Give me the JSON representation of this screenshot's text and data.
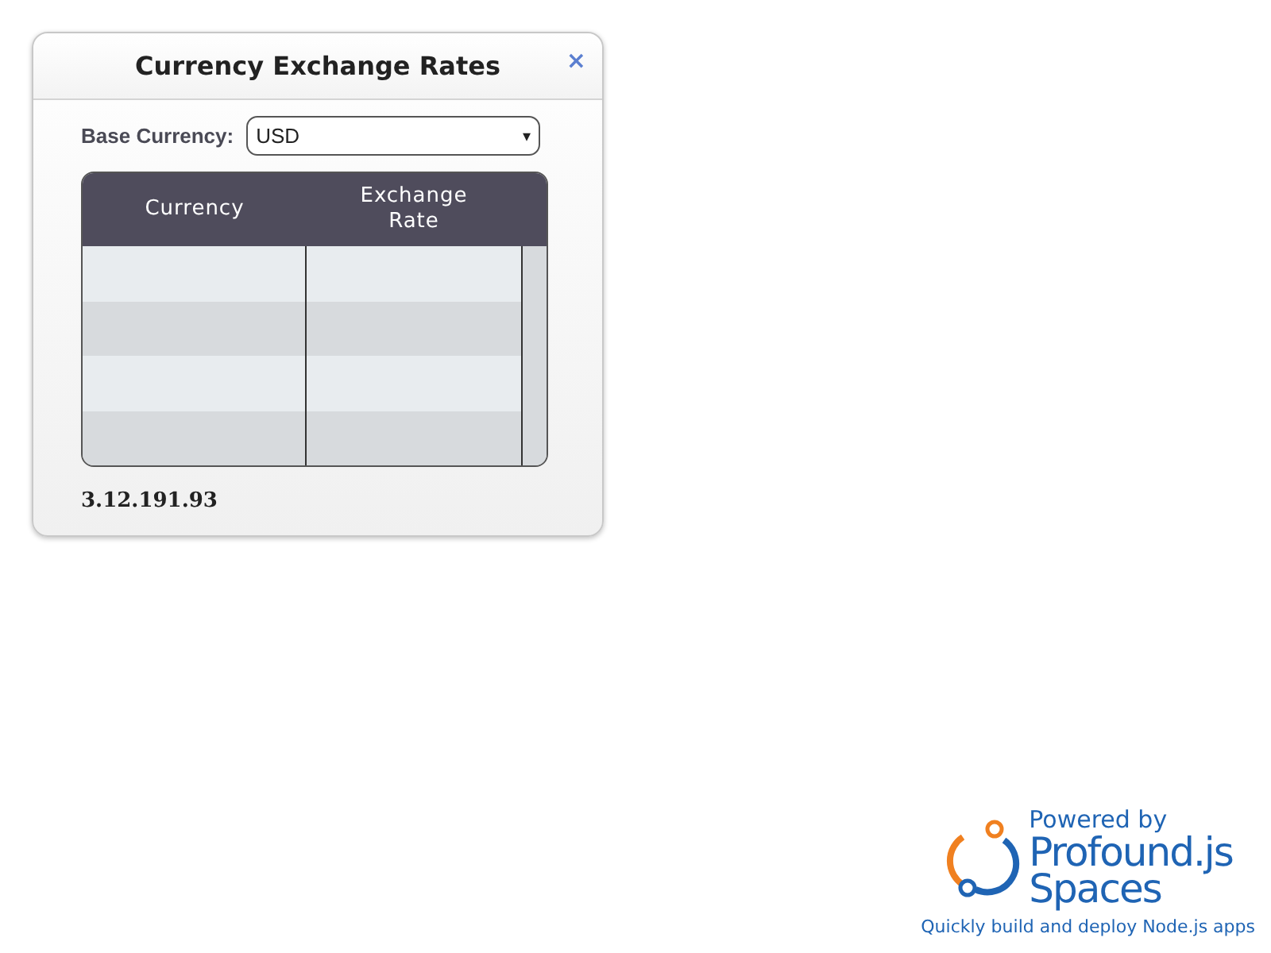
{
  "window": {
    "title": "Currency Exchange Rates",
    "close": "×"
  },
  "base_currency": {
    "label": "Base Currency:",
    "value": "USD",
    "caret": "▾"
  },
  "table": {
    "columns": [
      "Currency",
      "Exchange Rate"
    ]
  },
  "footer_text": "3.12.191.93",
  "branding": {
    "powered_by": "Powered by",
    "product_line_1": "Profound.js",
    "product_line_2": "Spaces",
    "tagline": "Quickly build and deploy Node.js apps"
  }
}
